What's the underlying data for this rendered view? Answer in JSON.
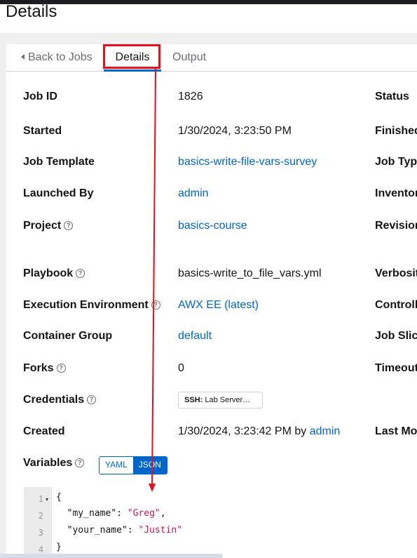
{
  "header": {
    "title": "Details"
  },
  "tabs": {
    "back": "Back to Jobs",
    "details": "Details",
    "output": "Output"
  },
  "left": {
    "job_id": {
      "label": "Job ID",
      "value": "1826"
    },
    "started": {
      "label": "Started",
      "value": "1/30/2024, 3:23:50 PM"
    },
    "job_template": {
      "label": "Job Template",
      "value": "basics-write-file-vars-survey"
    },
    "launched_by": {
      "label": "Launched By",
      "value": "admin"
    },
    "project": {
      "label": "Project",
      "value": "basics-course"
    },
    "playbook": {
      "label": "Playbook",
      "value": "basics-write_to_file_vars.yml"
    },
    "ee": {
      "label": "Execution Environment",
      "value": "AWX EE (latest)"
    },
    "container_group": {
      "label": "Container Group",
      "value": "default"
    },
    "forks": {
      "label": "Forks",
      "value": "0"
    },
    "credentials": {
      "label": "Credentials",
      "chip_type": "SSH:",
      "chip_name": "Lab Server…"
    },
    "created": {
      "label": "Created",
      "value": "1/30/2024, 3:23:42 PM by",
      "by": "admin"
    },
    "variables": {
      "label": "Variables",
      "yaml": "YAML",
      "json": "JSON"
    }
  },
  "right": {
    "status": "Status",
    "finished": "Finished",
    "job_type": "Job Type",
    "inventory": "Inventory",
    "revision": "Revision",
    "verbosity": "Verbosity",
    "controller": "Controller",
    "job_slice": "Job Slice",
    "timeout": "Timeout",
    "last_modified": "Last Mo"
  },
  "editor": {
    "line_numbers": [
      "1",
      "2",
      "3",
      "4"
    ],
    "open_brace": "{",
    "key1": "\"my_name\"",
    "val1": "\"Greg\"",
    "key2": "\"your_name\"",
    "val2": "\"Justin\"",
    "close_brace": "}"
  },
  "annotation": {
    "color": "#e3101e"
  }
}
